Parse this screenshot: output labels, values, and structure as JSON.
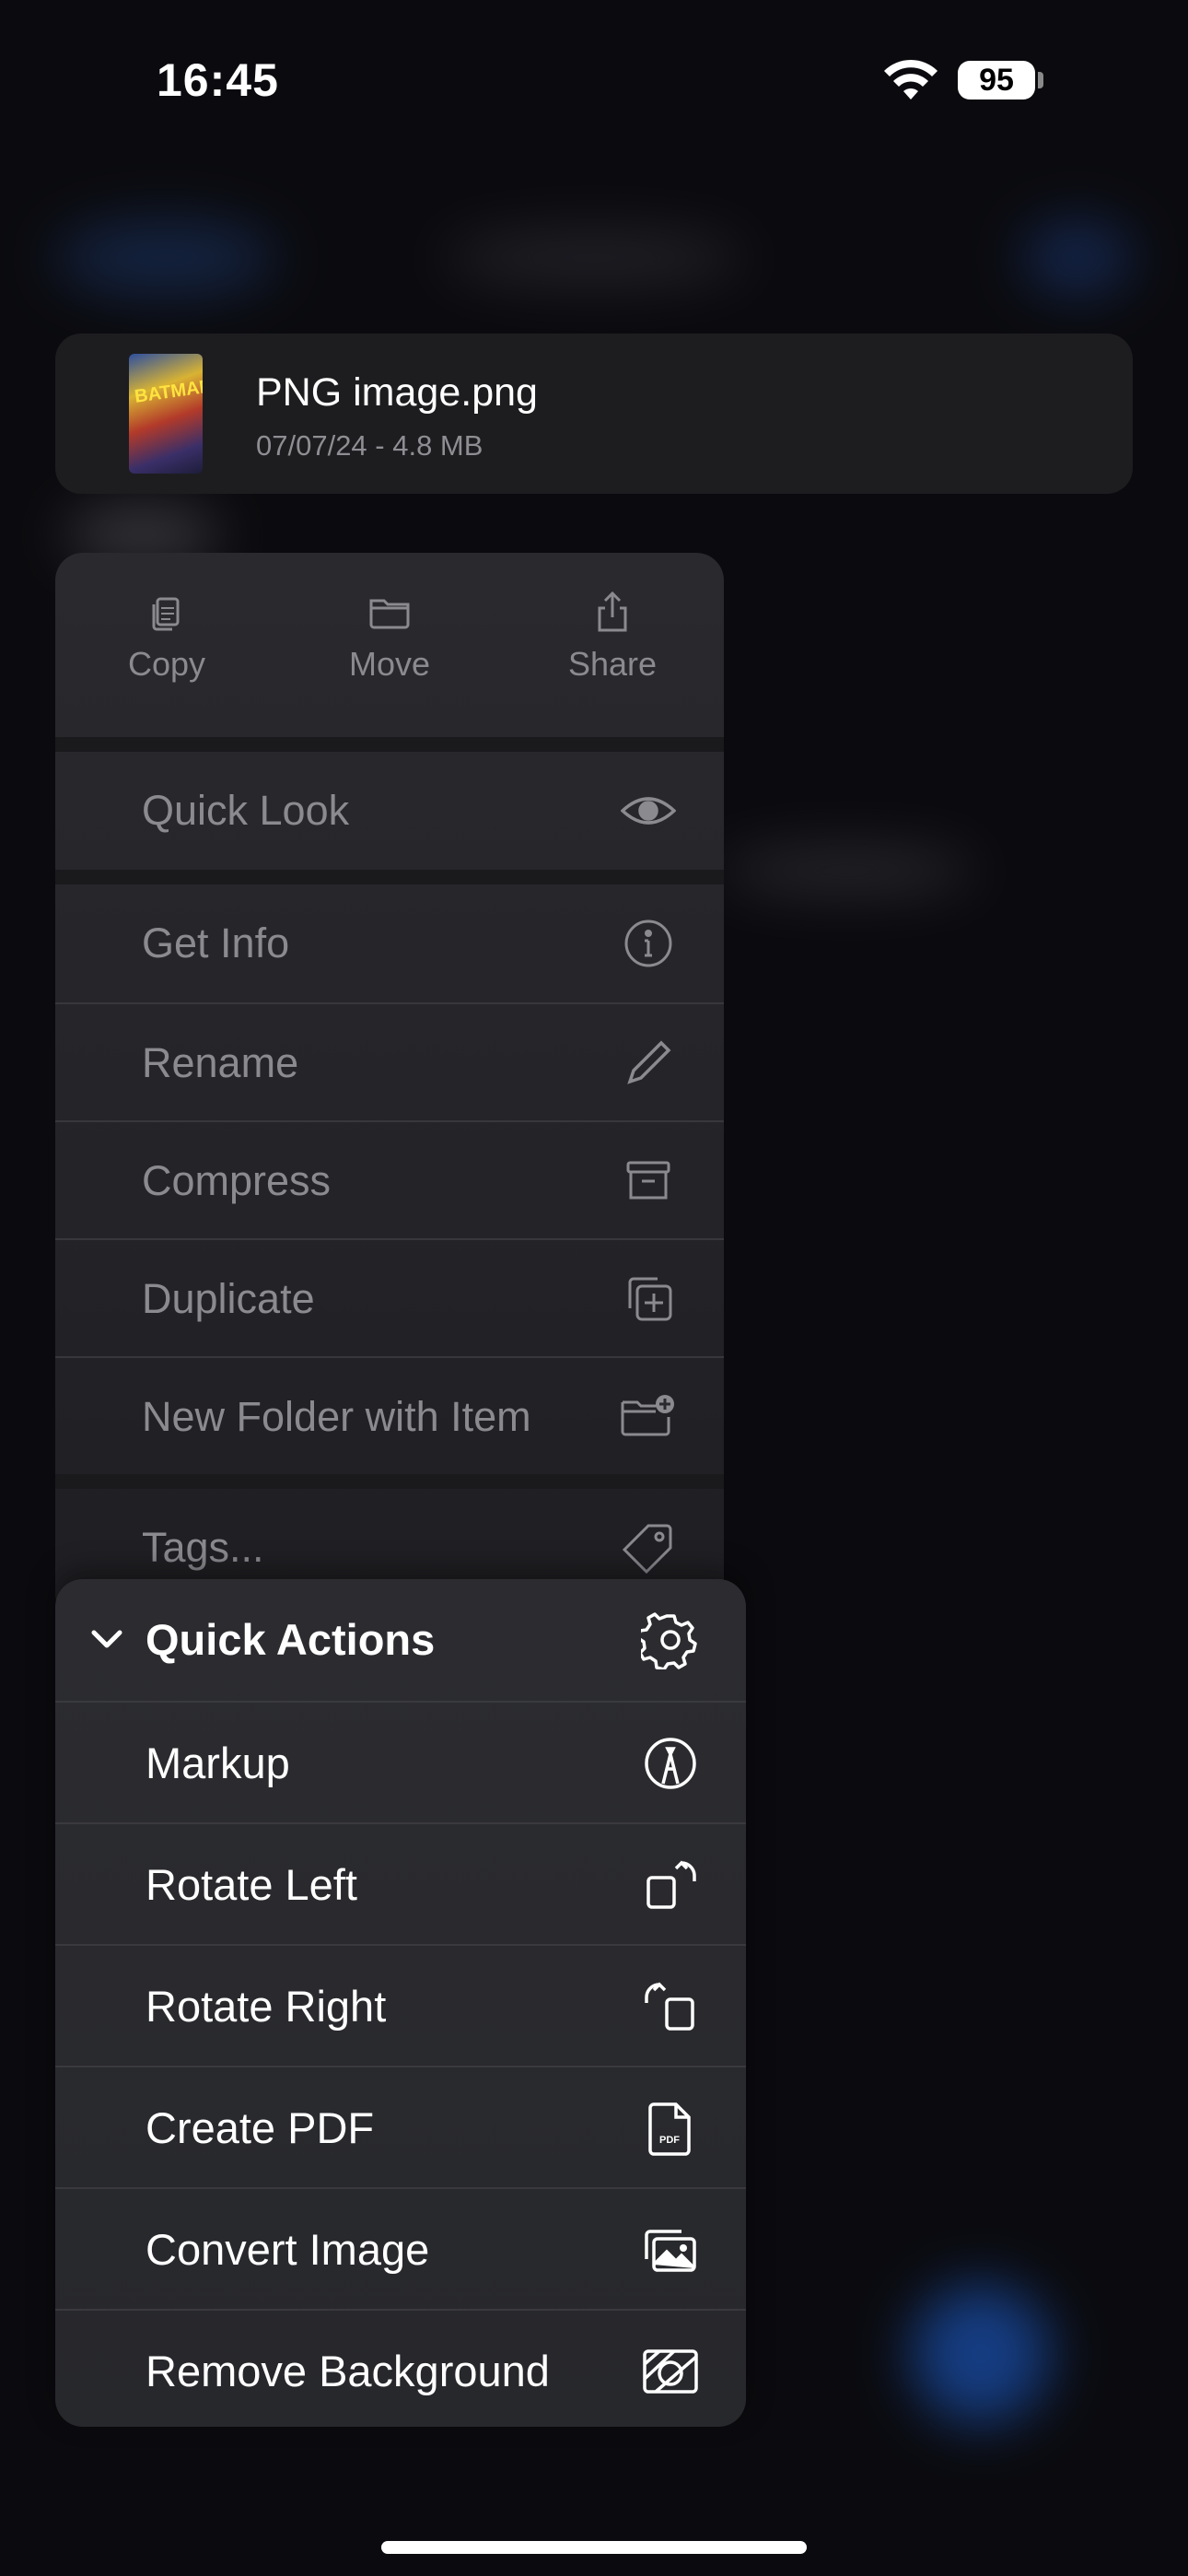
{
  "status_bar": {
    "time": "16:45",
    "battery": "95"
  },
  "file": {
    "name": "PNG image.png",
    "meta": "07/07/24 - 4.8 MB",
    "thumb_text": "BATMAN"
  },
  "top_actions": [
    {
      "label": "Copy",
      "icon": "copy-icon"
    },
    {
      "label": "Move",
      "icon": "folder-icon"
    },
    {
      "label": "Share",
      "icon": "share-icon"
    }
  ],
  "menu": [
    {
      "label": "Quick Look",
      "icon": "eye-icon"
    },
    {
      "label": "Get Info",
      "icon": "info-icon"
    },
    {
      "label": "Rename",
      "icon": "pencil-icon"
    },
    {
      "label": "Compress",
      "icon": "archive-box-icon"
    },
    {
      "label": "Duplicate",
      "icon": "duplicate-icon"
    },
    {
      "label": "New Folder with Item",
      "icon": "folder-plus-icon"
    },
    {
      "label": "Tags...",
      "icon": "tag-icon"
    }
  ],
  "quick_actions": {
    "header": "Quick Actions",
    "items": [
      {
        "label": "Markup",
        "icon": "markup-icon"
      },
      {
        "label": "Rotate Left",
        "icon": "rotate-left-icon"
      },
      {
        "label": "Rotate Right",
        "icon": "rotate-right-icon"
      },
      {
        "label": "Create PDF",
        "icon": "pdf-document-icon"
      },
      {
        "label": "Convert Image",
        "icon": "photos-icon"
      },
      {
        "label": "Remove Background",
        "icon": "remove-background-icon"
      }
    ]
  },
  "colors": {
    "background": "#0b0b0f",
    "menu": "#2a2a2e",
    "dim_text": "#8a8a8f",
    "accent_blur": "#1d5fd0"
  }
}
